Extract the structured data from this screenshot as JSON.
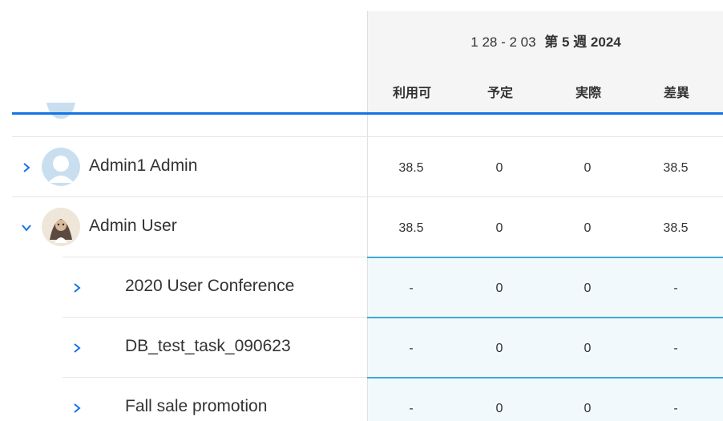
{
  "week": {
    "range": "1 28 - 2 03",
    "label": "第 5 週 2024"
  },
  "columns": [
    "利用可",
    "予定",
    "実際",
    "差異"
  ],
  "users": [
    {
      "name": "Admin1 Admin",
      "avatar": "default-user-avatar",
      "expanded": false,
      "values": [
        "38.5",
        "0",
        "0",
        "38.5"
      ]
    },
    {
      "name": "Admin User",
      "avatar": "photo-avatar",
      "expanded": true,
      "values": [
        "38.5",
        "0",
        "0",
        "38.5"
      ]
    }
  ],
  "projects": [
    {
      "name": "2020 User Conference",
      "values": [
        "-",
        "0",
        "0",
        "-"
      ]
    },
    {
      "name": "DB_test_task_090623",
      "values": [
        "-",
        "0",
        "0",
        "-"
      ]
    },
    {
      "name": "Fall sale promotion",
      "values": [
        "-",
        "0",
        "0",
        "-"
      ]
    }
  ],
  "colors": {
    "accent": "#1473e6",
    "subrow_separator": "#40a9d4",
    "subrow_background": "#f1f9fd",
    "header_background": "#f5f5f5"
  }
}
